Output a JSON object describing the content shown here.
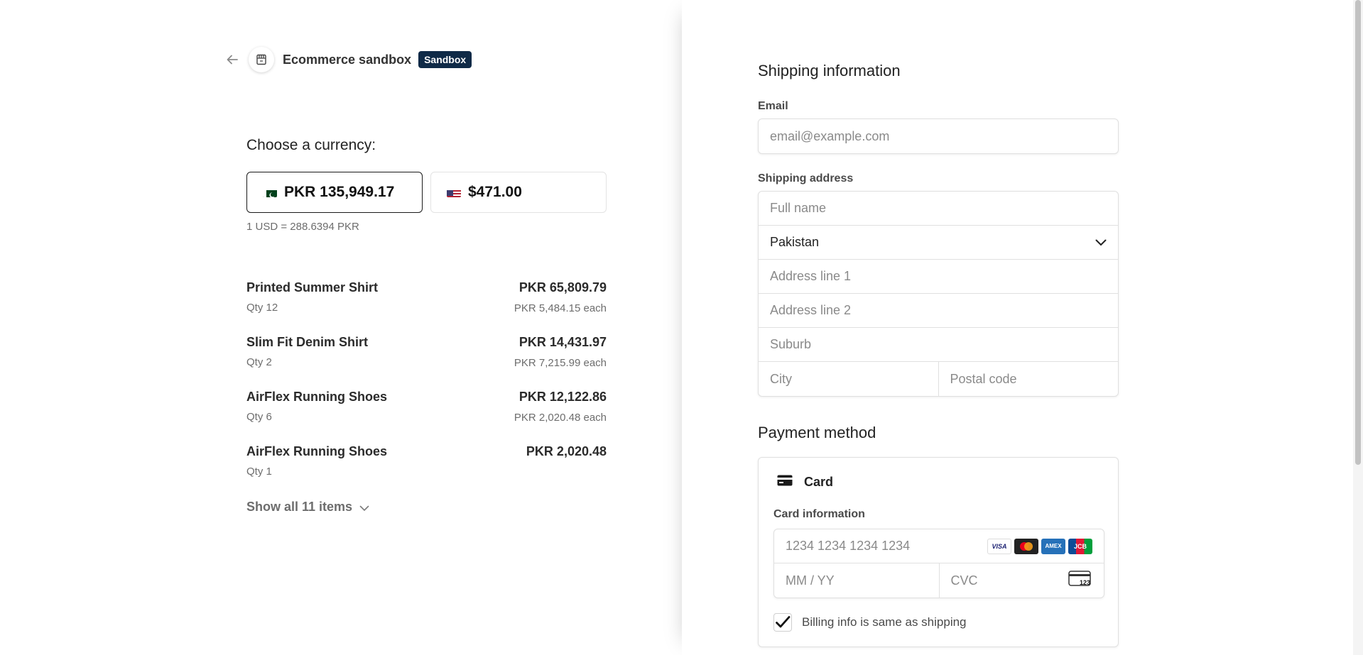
{
  "header": {
    "store_name": "Ecommerce sandbox",
    "badge": "Sandbox"
  },
  "currency": {
    "label": "Choose a currency:",
    "options": [
      {
        "label": "PKR 135,949.17",
        "flag": "pakistan-flag-icon",
        "selected": true
      },
      {
        "label": "$471.00",
        "flag": "us-flag-icon",
        "selected": false
      }
    ],
    "rate": "1 USD = 288.6394 PKR"
  },
  "items": [
    {
      "name": "Printed Summer Shirt",
      "qty": "Qty 12",
      "total": "PKR 65,809.79",
      "each": "PKR 5,484.15 each"
    },
    {
      "name": "Slim Fit Denim Shirt",
      "qty": "Qty 2",
      "total": "PKR 14,431.97",
      "each": "PKR 7,215.99 each"
    },
    {
      "name": "AirFlex Running Shoes",
      "qty": "Qty 6",
      "total": "PKR 12,122.86",
      "each": "PKR 2,020.48 each"
    },
    {
      "name": "AirFlex Running Shoes",
      "qty": "Qty 1",
      "total": "PKR 2,020.48",
      "each": ""
    }
  ],
  "show_all": "Show all 11 items",
  "shipping": {
    "title": "Shipping information",
    "email_label": "Email",
    "email_placeholder": "email@example.com",
    "address_label": "Shipping address",
    "full_name_placeholder": "Full name",
    "country": "Pakistan",
    "address1_placeholder": "Address line 1",
    "address2_placeholder": "Address line 2",
    "suburb_placeholder": "Suburb",
    "city_placeholder": "City",
    "postal_placeholder": "Postal code"
  },
  "payment": {
    "title": "Payment method",
    "method": "Card",
    "card_info_label": "Card information",
    "card_number_placeholder": "1234 1234 1234 1234",
    "expiry_placeholder": "MM / YY",
    "cvc_placeholder": "CVC",
    "cvc_icon_text": "123",
    "brands": [
      "VISA",
      "mastercard",
      "AMEX",
      "JCB"
    ],
    "billing_same": "Billing info is same as shipping",
    "billing_checked": true
  },
  "colors": {
    "badge_bg": "#0f2a47",
    "border": "#e0e0e0",
    "text_muted": "#6d6d6d"
  }
}
